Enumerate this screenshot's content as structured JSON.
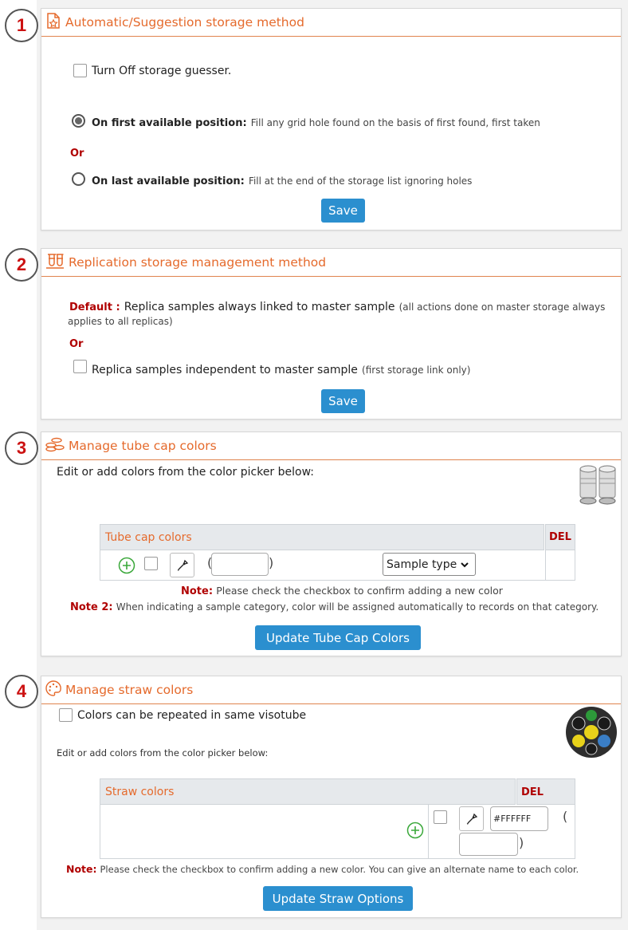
{
  "section1": {
    "number": "1",
    "title": "Automatic/Suggestion storage method",
    "turn_off_label": "Turn Off storage guesser.",
    "first_label": "On first available position:",
    "first_desc": "Fill any grid hole found on the basis of first found, first taken",
    "or": "Or",
    "last_label": "On last available position:",
    "last_desc": "Fill at the end of the storage list ignoring holes",
    "save": "Save"
  },
  "section2": {
    "number": "2",
    "title": "Replication storage management method",
    "default_label": "Default :",
    "default_text": "Replica samples always linked to master sample",
    "default_note_a": "(all actions done on master storage always",
    "default_note_b": "applies to all replicas)",
    "or": "Or",
    "independent_label": "Replica samples independent to master sample",
    "independent_note": "(first storage link only)",
    "save": "Save"
  },
  "section3": {
    "number": "3",
    "title": "Manage tube cap colors",
    "intro": "Edit or add colors from the color picker below:",
    "table_header": "Tube cap colors",
    "del": "DEL",
    "sample_type": "Sample type",
    "note_label": "Note:",
    "note_text": "Please check the checkbox to confirm adding a new color",
    "note2_label": "Note 2:",
    "note2_text": "When indicating a sample category, color will be assigned automatically to records on that category.",
    "button": "Update Tube Cap Colors"
  },
  "section4": {
    "number": "4",
    "title": "Manage straw colors",
    "repeat_label": "Colors can be repeated in same visotube",
    "intro": "Edit or add colors from the color picker below:",
    "table_header": "Straw colors",
    "del": "DEL",
    "color_value": "#FFFFFF",
    "note_label": "Note:",
    "note_text": "Please check the checkbox to confirm adding a new color. You can give an alternate name to each color.",
    "button": "Update Straw Options"
  },
  "colors": {
    "accent": "#e56a2c",
    "button": "#2b8fcf",
    "note_red": "#b00000",
    "add_green": "#3aa83a"
  }
}
